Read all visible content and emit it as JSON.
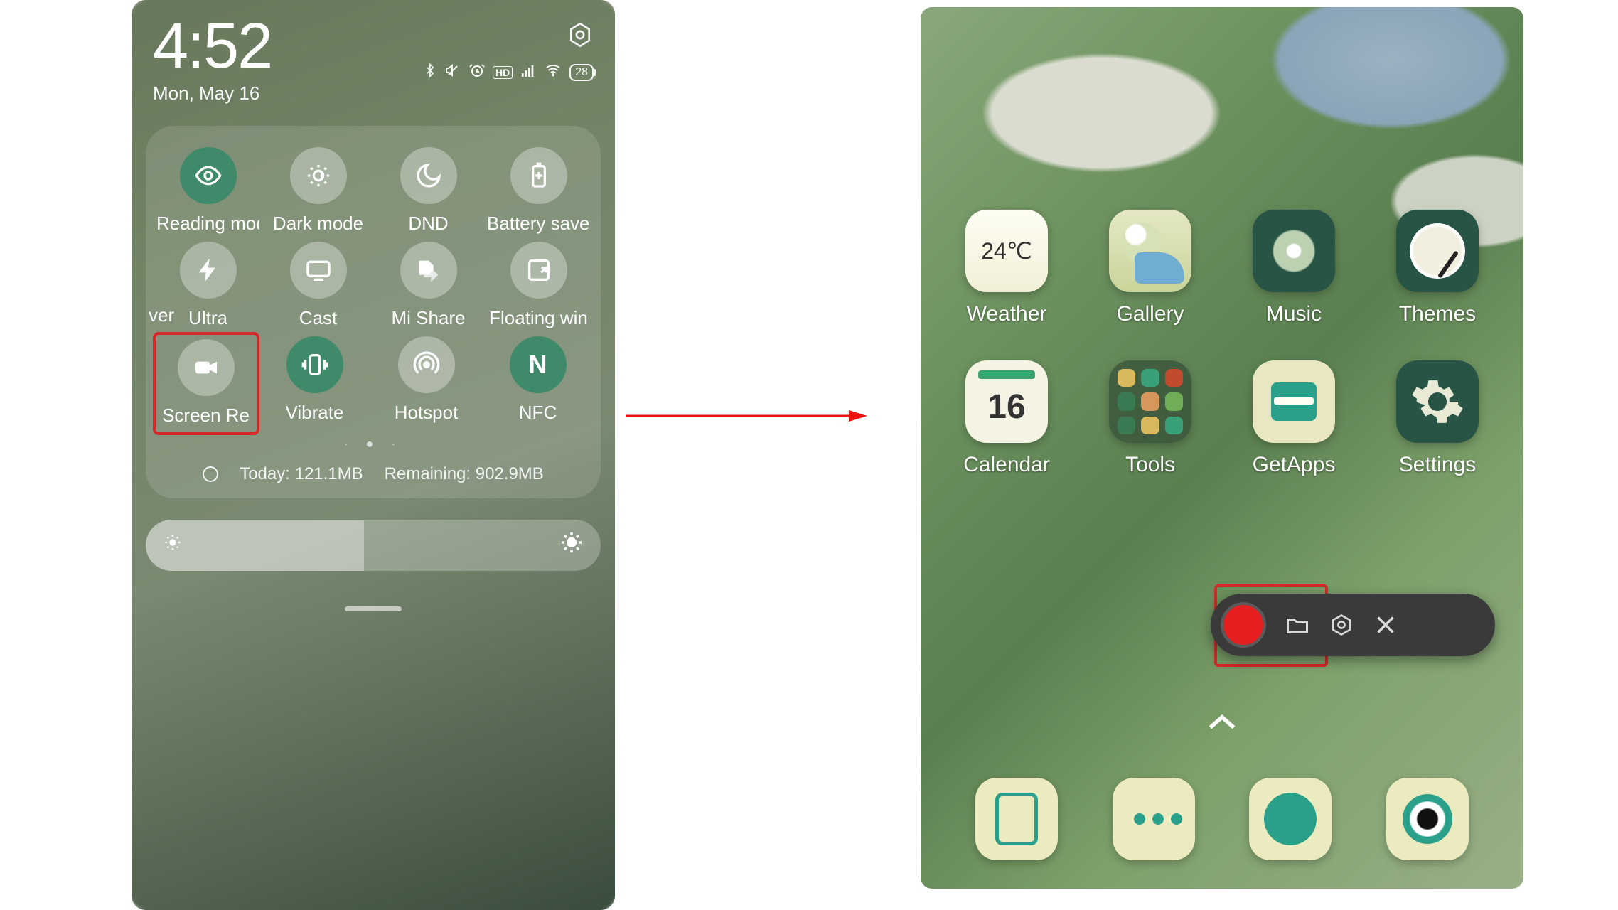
{
  "left": {
    "time": "4:52",
    "date": "Mon, May 16",
    "battery": "28",
    "tiles": {
      "row1": [
        {
          "label": "Reading mode",
          "active": true
        },
        {
          "label": "Dark mode",
          "active": false
        },
        {
          "label": "DND",
          "active": false
        },
        {
          "label": "Battery saver",
          "active": false
        }
      ],
      "row2_prefix": "ver",
      "row2": [
        {
          "label": "Ultra",
          "active": false
        },
        {
          "label": "Cast",
          "active": false
        },
        {
          "label": "Mi Share",
          "active": false
        },
        {
          "label": "Floating win",
          "active": false
        }
      ],
      "row3": [
        {
          "label": "Screen Re",
          "active": false,
          "highlighted": true
        },
        {
          "label": "Vibrate",
          "active": true
        },
        {
          "label": "Hotspot",
          "active": false
        },
        {
          "label": "NFC",
          "active": true
        }
      ]
    },
    "data_today_label": "Today:",
    "data_today_value": "121.1MB",
    "data_remaining_label": "Remaining:",
    "data_remaining_value": "902.9MB"
  },
  "right": {
    "weather_temp": "24℃",
    "calendar_day": "16",
    "apps_row1": [
      "Weather",
      "Gallery",
      "Music",
      "Themes"
    ],
    "apps_row2": [
      "Calendar",
      "Tools",
      "GetApps",
      "Settings"
    ]
  }
}
